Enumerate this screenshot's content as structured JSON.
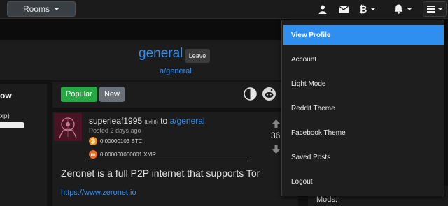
{
  "topbar": {
    "rooms_label": "Rooms",
    "icons": [
      "user-icon",
      "mail-icon",
      "bitcoin-icon",
      "bell-icon",
      "hamburger-menu-icon"
    ]
  },
  "channel": {
    "title": "general",
    "leave_label": "Leave",
    "path": "a/general"
  },
  "sidebar": {
    "title": "ow",
    "xp_text": "xp)",
    "progress_fraction": 1.0
  },
  "feed": {
    "popular_label": "Popular",
    "new_label": "New",
    "icons": [
      "theme-toggle-icon",
      "reddit-icon"
    ]
  },
  "post": {
    "author": "superleaf1995",
    "level": "(Lvl 8)",
    "to_text": "to",
    "room": "a/general",
    "posted": "Posted 2 days ago",
    "tip_btc": "0.00000103 BTC",
    "tip_xmr": "0.000000000001 XMR",
    "body": "Zeronet is a full P2P internet that supports Tor",
    "link": "https://www.zeronet.io",
    "votes": "36"
  },
  "mods": {
    "label": "Mods:"
  },
  "dropdown": {
    "items": [
      {
        "label": "View Profile",
        "active": true
      },
      {
        "label": "Account"
      },
      {
        "label": "Light Mode"
      },
      {
        "label": "Reddit Theme"
      },
      {
        "label": "Facebook Theme"
      },
      {
        "label": "Saved Posts"
      },
      {
        "label": "Logout"
      }
    ]
  },
  "colors": {
    "accent": "#2f8ff0",
    "success": "#28a745",
    "background": "#121212",
    "panel": "#1c1c1c"
  }
}
